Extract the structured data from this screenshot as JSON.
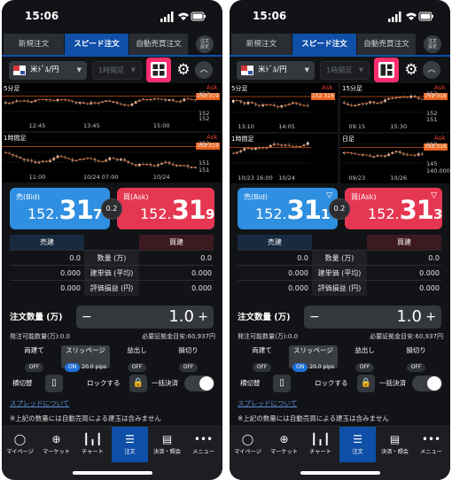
{
  "colors": {
    "bid": "#2f8fe0",
    "ask": "#e63752",
    "accent": "#0f4fa8",
    "highlight": "#ff2e6e",
    "price_tag": "#e8641e"
  },
  "phones": [
    {
      "time": "15:06",
      "tabs": [
        "新規注文",
        "スピード注文",
        "自動売買注文"
      ],
      "settings_label_1": "注文",
      "settings_label_2": "設定",
      "pair": "米ﾄﾞﾙ/円",
      "timeframe": "1時間足",
      "layout_icon": "grid-4-icon",
      "charts": [
        {
          "label": "5分足",
          "ask": "Ask",
          "price": "152.319",
          "y_ticks": [
            "152",
            "152",
            "152"
          ],
          "x_ticks": [
            "12:45",
            "13:45",
            "15:00"
          ]
        },
        {
          "label": "1時間足",
          "ask": "Ask",
          "price": "152.319",
          "y_ticks": [
            "152",
            "151",
            "151"
          ],
          "x_ticks": [
            "11:00",
            "10/24 07:00",
            "10/24"
          ]
        }
      ],
      "bid": {
        "label": "売(Bid)",
        "small": "152.",
        "big": "31",
        "last": "7",
        "show_triangle": false
      },
      "ask": {
        "label": "買(Ask)",
        "small": "152.",
        "big": "31",
        "last": "9",
        "show_triangle": false
      },
      "spread": "0.2",
      "table": {
        "header_left": "売建",
        "header_right": "買建",
        "rows": [
          {
            "left": "0.0",
            "mid": "数量 (万)",
            "right": "0.0"
          },
          {
            "left": "0.000",
            "mid": "建単価 (平均)",
            "right": "0.000"
          },
          {
            "left": "0.000",
            "mid": "評価損益 (円)",
            "right": "0.000"
          }
        ]
      },
      "order_qty_label": "注文数量 (万)",
      "order_qty": "1.0",
      "avail_left": "発注可能数量(万):0.0",
      "avail_right": "必要証拠金目安:60,937円",
      "options": [
        {
          "label": "両建て",
          "state": "OFF"
        },
        {
          "label": "スリッページ",
          "on": "ON",
          "value": "20.0 pips"
        },
        {
          "label": "益出し",
          "state": "OFF"
        },
        {
          "label": "損切り",
          "state": "OFF"
        }
      ],
      "landscape": "横切替",
      "lock": "ロックする",
      "bulk": "一括決済",
      "spread_link": "スプレッドについて",
      "note": "※上記の数量には自動売買による建玉は含みません",
      "nav": [
        "マイページ",
        "マーケット",
        "チャート",
        "注文",
        "決済・照会",
        "メニュー"
      ]
    },
    {
      "time": "15:06",
      "tabs": [
        "新規注文",
        "スピード注文",
        "自動売買注文"
      ],
      "settings_label_1": "注文",
      "settings_label_2": "設定",
      "pair": "米ﾄﾞﾙ/円",
      "timeframe": "1時間足",
      "layout_icon": "grid-split-icon",
      "charts": [
        {
          "label": "5分足",
          "ask": "Ask",
          "price": "152.316",
          "y_ticks": [],
          "x_ticks": [
            "13:10",
            "14:05"
          ]
        },
        {
          "label": "15分足",
          "ask": "Ask",
          "price": "152.316",
          "y_ticks": [
            "152",
            "152",
            "151"
          ],
          "x_ticks": [
            "09:15",
            "15:30"
          ]
        },
        {
          "label": "1時間足",
          "ask": "",
          "price": "",
          "y_ticks": [],
          "x_ticks": [
            "10/23 16:00",
            "10/24"
          ]
        },
        {
          "label": "日足",
          "ask": "Ask",
          "price": "152.316",
          "y_ticks": [
            "150",
            "145",
            "140.000"
          ],
          "x_ticks": [
            "09/23",
            "10/26"
          ]
        }
      ],
      "bid": {
        "label": "売(Bid)",
        "small": "152.",
        "big": "31",
        "last": "1",
        "show_triangle": true
      },
      "ask": {
        "label": "買(Ask)",
        "small": "152.",
        "big": "31",
        "last": "3",
        "show_triangle": true
      },
      "spread": "0.2",
      "table": {
        "header_left": "売建",
        "header_right": "買建",
        "rows": [
          {
            "left": "0.0",
            "mid": "数量 (万)",
            "right": "0.0"
          },
          {
            "left": "0.000",
            "mid": "建単価 (平均)",
            "right": "0.000"
          },
          {
            "left": "0.000",
            "mid": "評価損益 (円)",
            "right": "0.000"
          }
        ]
      },
      "order_qty_label": "注文数量 (万)",
      "order_qty": "1.0",
      "avail_left": "発注可能数量(万):0.0",
      "avail_right": "必要証拠金目安:60,937円",
      "options": [
        {
          "label": "両建て",
          "state": "OFF"
        },
        {
          "label": "スリッページ",
          "on": "ON",
          "value": "20.0 pips"
        },
        {
          "label": "益出し",
          "state": "OFF"
        },
        {
          "label": "損切り",
          "state": "OFF"
        }
      ],
      "landscape": "横切替",
      "lock": "ロックする",
      "bulk": "一括決済",
      "spread_link": "スプレッドについて",
      "note": "※上記の数量には自動売買による建玉は含みません",
      "nav": [
        "マイページ",
        "マーケット",
        "チャート",
        "注文",
        "決済・照会",
        "メニュー"
      ]
    }
  ]
}
